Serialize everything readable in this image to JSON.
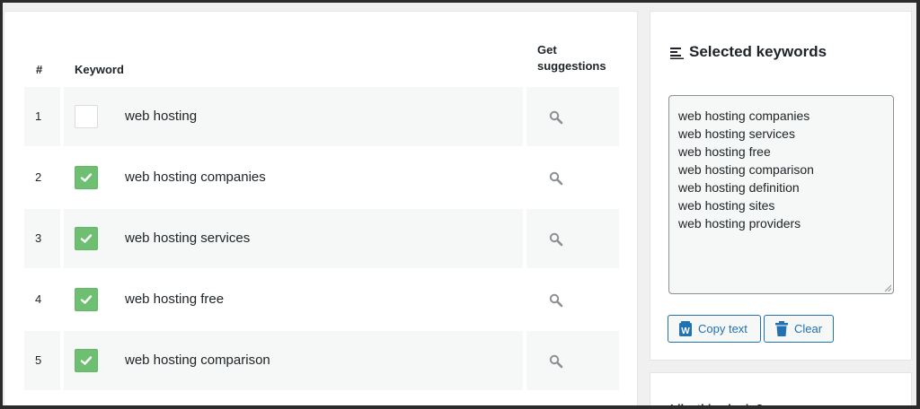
{
  "table": {
    "headers": {
      "number": "#",
      "keyword": "Keyword",
      "suggestions": "Get suggestions"
    },
    "rows": [
      {
        "number": "1",
        "keyword": "web hosting",
        "checked": false
      },
      {
        "number": "2",
        "keyword": "web hosting companies",
        "checked": true
      },
      {
        "number": "3",
        "keyword": "web hosting services",
        "checked": true
      },
      {
        "number": "4",
        "keyword": "web hosting free",
        "checked": true
      },
      {
        "number": "5",
        "keyword": "web hosting comparison",
        "checked": true
      }
    ]
  },
  "sidebar": {
    "title": "Selected keywords",
    "selected_keywords": [
      "web hosting companies",
      "web hosting services",
      "web hosting free",
      "web hosting comparison",
      "web hosting definition",
      "web hosting sites",
      "web hosting providers"
    ],
    "copy_label": "Copy text",
    "clear_label": "Clear",
    "promo_title": "Like this plugin?"
  },
  "colors": {
    "accent": "#2271b1",
    "checkbox_checked": "#6fbf73",
    "row_shade": "#f6f7f7",
    "page_bg": "#f0f0f1"
  },
  "icons": {
    "suggestion": "magnifier-icon",
    "title": "text-lines-icon",
    "copy": "copy-doc-icon",
    "clear": "trash-icon"
  }
}
